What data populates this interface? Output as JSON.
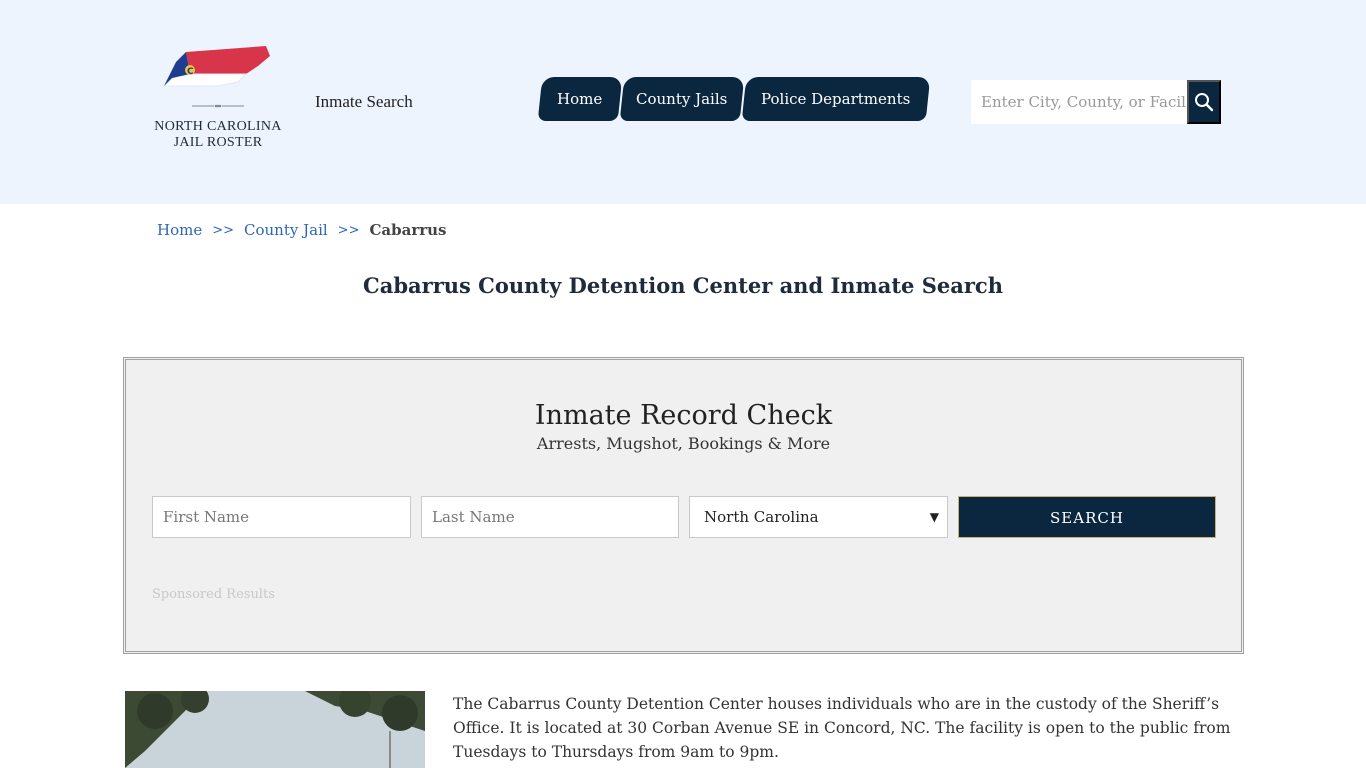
{
  "header": {
    "logo_line1": "NORTH CAROLINA",
    "logo_line2": "JAIL ROSTER",
    "logo_badge": "C",
    "site_link": "Inmate Search",
    "nav": [
      {
        "label": "Home"
      },
      {
        "label": "County Jails"
      },
      {
        "label": "Police Departments"
      }
    ],
    "search_placeholder": "Enter City, County, or Facil"
  },
  "breadcrumb": {
    "home": "Home",
    "sep": ">>",
    "county_jail": "County Jail",
    "current": "Cabarrus"
  },
  "page_title": "Cabarrus County Detention Center and Inmate Search",
  "record_check": {
    "title": "Inmate Record Check",
    "subtitle": "Arrests, Mugshot, Bookings & More",
    "first_name_placeholder": "First Name",
    "last_name_placeholder": "Last Name",
    "state_selected": "North Carolina",
    "search_label": "SEARCH",
    "sponsored": "Sponsored Results"
  },
  "intro": "The Cabarrus County Detention Center houses individuals who are in the custody of the Sheriff’s Office. It is located at 30 Corban Avenue SE in Concord, NC. The facility is open to the public from Tuesdays to Thursdays from 9am to 9pm.",
  "colors": {
    "header_bg": "#edf4fe",
    "nav_bg": "#0b2740",
    "link": "#2e66b8"
  }
}
